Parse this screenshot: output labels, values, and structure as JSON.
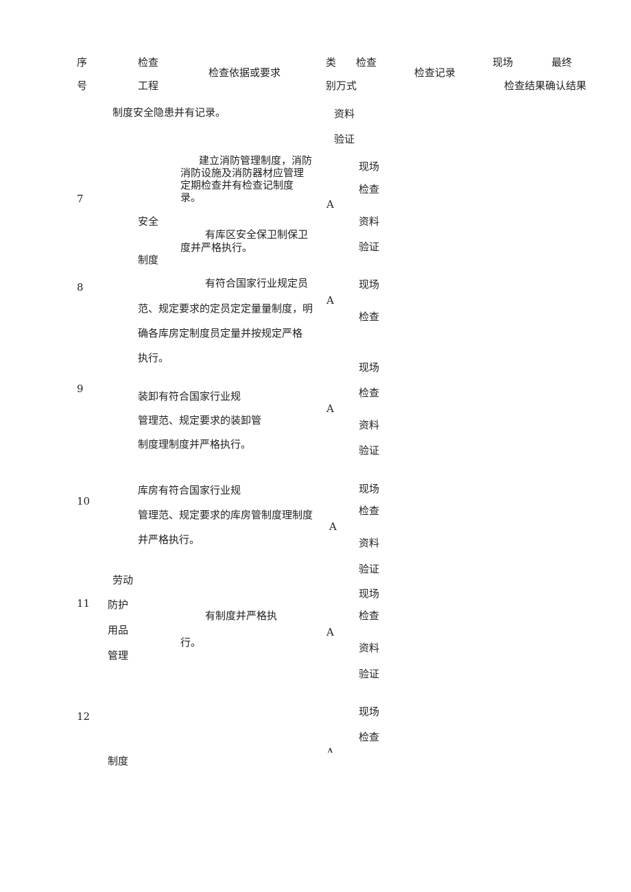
{
  "header": {
    "seq_1": "序",
    "seq_2": "号",
    "item_1": "检查",
    "item_2": "工程",
    "basis": "检查依据或要求",
    "cat_1": "类",
    "method_1": "检查",
    "cat_method_2": "别万式",
    "record": "检查记录",
    "site_1": "现场",
    "final_1": "最终",
    "result_2": "检查结果确认结果"
  },
  "rows": {
    "r6": {
      "req": "制度安全隐患并有记录。",
      "m1": "资料",
      "m2": "验证"
    },
    "r7": {
      "no": "7",
      "req_1": "建立消防管理制度，消防",
      "req_2": "消防设施及消防器材应管理",
      "req_3": "定期检查并有检查记制度",
      "req_4": "录。",
      "cat": "A",
      "m1": "现场",
      "m2": "检查",
      "m3": "资料",
      "m4": "验证"
    },
    "group_safety": {
      "l1": "安全",
      "l2": "制度"
    },
    "r7b": {
      "req_1": "有库区安全保卫制保卫",
      "req_2": "度并严格执行。"
    },
    "r8": {
      "no": "8",
      "req_1": "有符合国家行业规定员",
      "req_2": "范、规定要求的定员定定量量制度，明",
      "req_3": "确各库房定制度员定量并按规定严格",
      "req_4": "执行。",
      "cat": "A",
      "m1": "现场",
      "m2": "检查"
    },
    "r9": {
      "no": "9",
      "req_1": "装卸有符合国家行业规",
      "req_2": "管理范、规定要求的装卸管",
      "req_3": "制度理制度并严格执行。",
      "cat": "A",
      "m1": "现场",
      "m2": "检查",
      "m3": "资料",
      "m4": "验证"
    },
    "r10": {
      "no": "10",
      "req_1": "库房有符合国家行业规",
      "req_2": "管理范、规定要求的库房管制度理制度",
      "req_3": "并严格执行。",
      "cat": "A",
      "m1": "现场",
      "m2": "检查",
      "m3": "资料",
      "m4": "验证"
    },
    "r11": {
      "no": "11",
      "g1": "劳动",
      "g2": "防护",
      "g3": "用品",
      "g4": "管理",
      "req_1": "有制度并严格执",
      "req_2": "行。",
      "cat": "A",
      "m1": "现场",
      "m2": "检查",
      "m3": "资料",
      "m4": "验证"
    },
    "r12": {
      "no": "12",
      "g1": "制度",
      "cat": "A",
      "m1": "现场",
      "m2": "检查"
    }
  }
}
